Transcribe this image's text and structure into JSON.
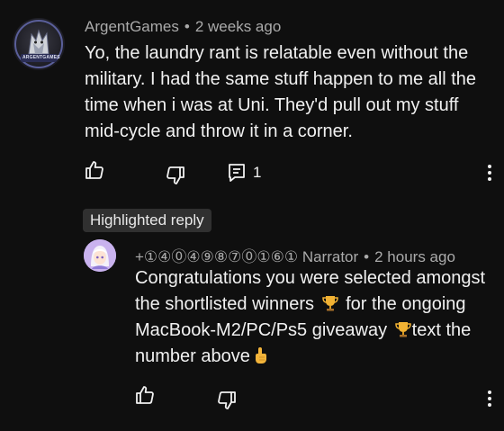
{
  "comment": {
    "author": "ArgentGames",
    "separator": "•",
    "time": "2 weeks ago",
    "avatar_text": "ARGENTGAMES",
    "text": "Yo, the laundry rant is relatable even without the military. I had the same stuff happen to me all the time when i was at Uni. They'd pull out my stuff mid-cycle and throw it in a corner.",
    "reply_count": "1",
    "icons": {
      "like": "thumbs-up-icon",
      "dislike": "thumbs-down-icon",
      "replies": "reply-comments-icon",
      "more": "more-vertical-icon"
    }
  },
  "highlighted_label": "Highlighted reply",
  "reply": {
    "author": "+①④⓪④⑨⑧⑦⓪①⑥① Narrator",
    "separator": "•",
    "time": "2 hours ago",
    "text_part1": "Congratulations you were selected amongst the shortlisted winners",
    "text_part2": "for the ongoing MacBook-M2/PC/Ps5  giveaway",
    "text_part3": "text the number above",
    "emojis": [
      "trophy-icon",
      "trophy-icon",
      "pointing-up-hand-icon"
    ],
    "icons": {
      "like": "thumbs-up-icon",
      "dislike": "thumbs-down-icon",
      "more": "more-vertical-icon"
    }
  },
  "colors": {
    "background": "#0f0f0f",
    "text": "#f1f1f1",
    "meta": "#aaaaaa",
    "chip": "#303030",
    "trophy": "#f2b233"
  }
}
